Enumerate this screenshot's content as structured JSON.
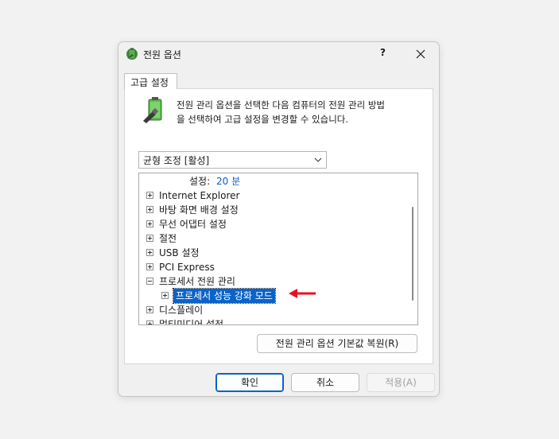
{
  "window": {
    "title": "전원 옵션",
    "help_label": "?",
    "icon": "power-options-icon"
  },
  "tab": {
    "label": "고급 설정"
  },
  "description": {
    "line1": "전원 관리 옵션을 선택한 다음 컴퓨터의 전원 관리 방법",
    "line2": "을 선택하여 고급 설정을 변경할 수 있습니다."
  },
  "plan_select": {
    "value": "균형 조정 [활성]"
  },
  "tree": {
    "setting": {
      "label": "설정:",
      "value": "20 분"
    },
    "items": [
      {
        "label": "Internet Explorer"
      },
      {
        "label": "바탕 화면 배경 설정"
      },
      {
        "label": "무선 어댑터 설정"
      },
      {
        "label": "절전"
      },
      {
        "label": "USB 설정"
      },
      {
        "label": "PCI Express"
      },
      {
        "label": "프로세서 전원 관리"
      }
    ],
    "selected_child": {
      "label": "프로세서 성능 강화 모드"
    },
    "after_items": [
      {
        "label": "디스플레이"
      },
      {
        "label": "멀티미디어 설정"
      }
    ]
  },
  "buttons": {
    "restore": "전원 관리 옵션 기본값 복원(R)",
    "ok": "확인",
    "cancel": "취소",
    "apply": "적용(A)"
  },
  "colors": {
    "accent": "#0a63c9",
    "arrow": "#e81123",
    "value_text": "#0a5cc8"
  }
}
